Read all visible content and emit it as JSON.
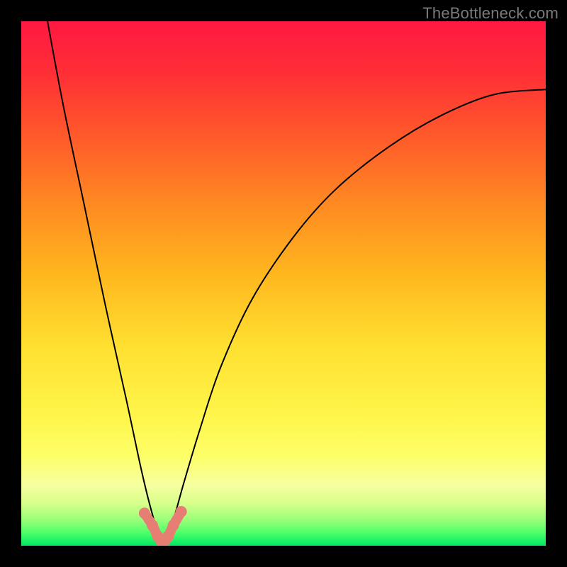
{
  "watermark": "TheBottleneck.com",
  "colors": {
    "page_background": "#000000",
    "curve_stroke": "#000000",
    "marker_stroke": "#e77e74",
    "watermark_text": "#7a7a7a"
  },
  "gradient_stops": [
    {
      "offset": 0.0,
      "color": "#ff1841"
    },
    {
      "offset": 0.1,
      "color": "#ff2f36"
    },
    {
      "offset": 0.22,
      "color": "#ff5a2a"
    },
    {
      "offset": 0.35,
      "color": "#ff8a22"
    },
    {
      "offset": 0.48,
      "color": "#ffb61e"
    },
    {
      "offset": 0.62,
      "color": "#ffe030"
    },
    {
      "offset": 0.75,
      "color": "#fff54a"
    },
    {
      "offset": 0.83,
      "color": "#fdff68"
    },
    {
      "offset": 0.885,
      "color": "#f6ffa0"
    },
    {
      "offset": 0.92,
      "color": "#d6ff8a"
    },
    {
      "offset": 0.95,
      "color": "#9bff7a"
    },
    {
      "offset": 0.975,
      "color": "#4fff6a"
    },
    {
      "offset": 1.0,
      "color": "#00e862"
    }
  ],
  "chart_data": {
    "type": "line",
    "title": "",
    "xlabel": "",
    "ylabel": "",
    "xlim": [
      0,
      100
    ],
    "ylim": [
      0,
      100
    ],
    "grid": false,
    "legend": false,
    "optimum_x": 27,
    "series": [
      {
        "name": "bottleneck_percent",
        "x": [
          5,
          8,
          12,
          16,
          20,
          23,
          25,
          27,
          29,
          31,
          34,
          38,
          44,
          52,
          60,
          70,
          80,
          90,
          100
        ],
        "y": [
          100,
          84,
          65,
          46,
          28,
          14,
          6,
          0,
          5,
          12,
          22,
          34,
          47,
          59,
          68,
          76,
          82,
          86,
          87
        ]
      }
    ],
    "marker": {
      "name": "optimum_band",
      "x": [
        23.5,
        25,
        26,
        27,
        28,
        29,
        30.5
      ],
      "y": [
        6.2,
        3.9,
        1.8,
        0.5,
        1.8,
        3.9,
        6.5
      ]
    },
    "annotations": []
  }
}
